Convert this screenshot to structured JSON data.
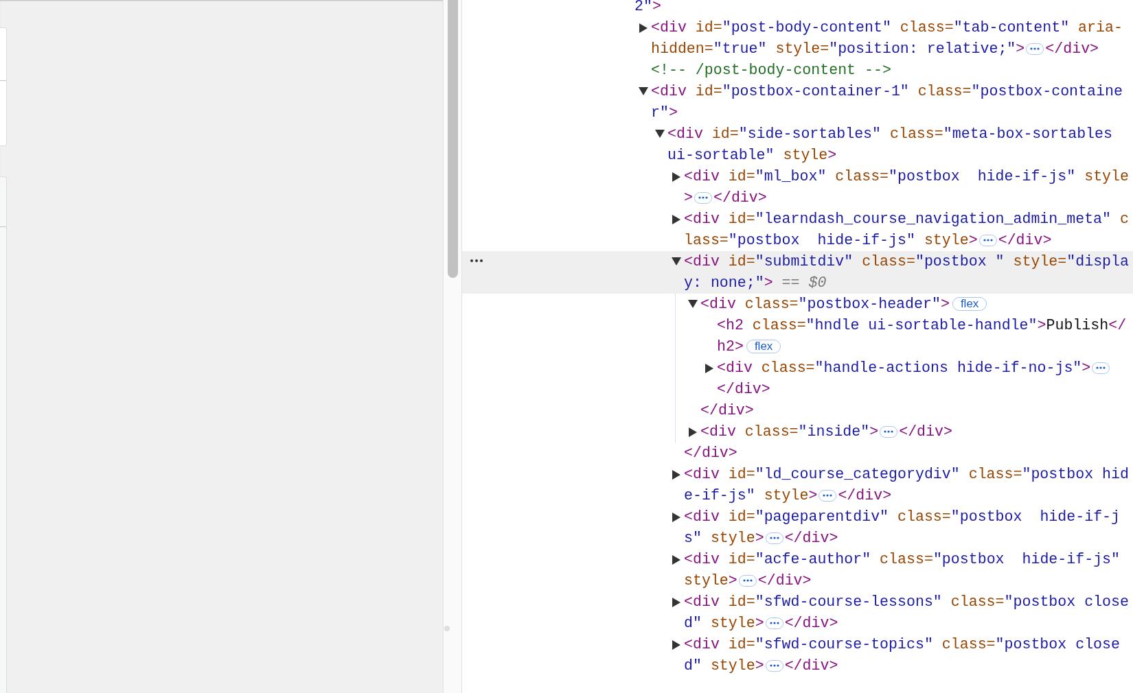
{
  "dom_tree": {
    "continuation_parts": [
      {
        "kind": "value",
        "text": "2\""
      },
      {
        "kind": "tag",
        "text": ">"
      }
    ],
    "nodes": [
      {
        "kind": "element",
        "expanded": false,
        "selected": false,
        "parts": [
          {
            "kind": "tag",
            "text": "<div"
          },
          {
            "kind": "attr",
            "text": " id="
          },
          {
            "kind": "value",
            "text": "\"post-body-content\""
          },
          {
            "kind": "attr",
            "text": " class="
          },
          {
            "kind": "value",
            "text": "\"tab-content\""
          },
          {
            "kind": "attr",
            "text": " aria-hidden="
          },
          {
            "kind": "value",
            "text": "\"true\""
          },
          {
            "kind": "attr",
            "text": " style="
          },
          {
            "kind": "value",
            "text": "\"position: relative;\""
          },
          {
            "kind": "tag",
            "text": ">"
          },
          {
            "kind": "ellipsis"
          },
          {
            "kind": "tag",
            "text": "</div>"
          }
        ]
      },
      {
        "kind": "comment",
        "parts": [
          {
            "kind": "comment",
            "text": "<!-- /post-body-content -->"
          }
        ]
      },
      {
        "kind": "element",
        "expanded": true,
        "selected": false,
        "parts": [
          {
            "kind": "tag",
            "text": "<div"
          },
          {
            "kind": "attr",
            "text": " id="
          },
          {
            "kind": "value",
            "text": "\"postbox-container-1\""
          },
          {
            "kind": "attr",
            "text": " class="
          },
          {
            "kind": "value",
            "text": "\"postbox-container\""
          },
          {
            "kind": "tag",
            "text": ">"
          }
        ],
        "children": [
          {
            "kind": "element",
            "expanded": true,
            "selected": false,
            "parts": [
              {
                "kind": "tag",
                "text": "<div"
              },
              {
                "kind": "attr",
                "text": " id="
              },
              {
                "kind": "value",
                "text": "\"side-sortables\""
              },
              {
                "kind": "attr",
                "text": " class="
              },
              {
                "kind": "value",
                "text": "\"meta-box-sortables ui-sortable\""
              },
              {
                "kind": "attr",
                "text": " style"
              },
              {
                "kind": "tag",
                "text": ">"
              }
            ],
            "children": [
              {
                "kind": "element",
                "expanded": false,
                "selected": false,
                "parts": [
                  {
                    "kind": "tag",
                    "text": "<div"
                  },
                  {
                    "kind": "attr",
                    "text": " id="
                  },
                  {
                    "kind": "value",
                    "text": "\"ml_box\""
                  },
                  {
                    "kind": "attr",
                    "text": " class="
                  },
                  {
                    "kind": "value",
                    "text": "\"postbox  hide-if-js\""
                  },
                  {
                    "kind": "attr",
                    "text": " style"
                  },
                  {
                    "kind": "tag",
                    "text": ">"
                  },
                  {
                    "kind": "ellipsis"
                  },
                  {
                    "kind": "tag",
                    "text": "</div>"
                  }
                ]
              },
              {
                "kind": "element",
                "expanded": false,
                "selected": false,
                "parts": [
                  {
                    "kind": "tag",
                    "text": "<div"
                  },
                  {
                    "kind": "attr",
                    "text": " id="
                  },
                  {
                    "kind": "value",
                    "text": "\"learndash_course_navigation_admin_meta\""
                  },
                  {
                    "kind": "attr",
                    "text": " class="
                  },
                  {
                    "kind": "value",
                    "text": "\"postbox  hide-if-js\""
                  },
                  {
                    "kind": "attr",
                    "text": " style"
                  },
                  {
                    "kind": "tag",
                    "text": ">"
                  },
                  {
                    "kind": "ellipsis"
                  },
                  {
                    "kind": "tag",
                    "text": "</div>"
                  }
                ]
              },
              {
                "kind": "element",
                "expanded": true,
                "selected": true,
                "parts": [
                  {
                    "kind": "tag",
                    "text": "<div"
                  },
                  {
                    "kind": "attr",
                    "text": " id="
                  },
                  {
                    "kind": "value",
                    "text": "\"submitdiv\""
                  },
                  {
                    "kind": "attr",
                    "text": " class="
                  },
                  {
                    "kind": "value",
                    "text": "\"postbox \""
                  },
                  {
                    "kind": "attr",
                    "text": " style="
                  },
                  {
                    "kind": "value",
                    "text": "\"display: none;\""
                  },
                  {
                    "kind": "tag",
                    "text": ">"
                  },
                  {
                    "kind": "marker",
                    "text": " == $0"
                  }
                ],
                "children": [
                  {
                    "kind": "element",
                    "expanded": true,
                    "selected": false,
                    "parts": [
                      {
                        "kind": "tag",
                        "text": "<div"
                      },
                      {
                        "kind": "attr",
                        "text": " class="
                      },
                      {
                        "kind": "value",
                        "text": "\"postbox-header\""
                      },
                      {
                        "kind": "tag",
                        "text": ">"
                      },
                      {
                        "kind": "badge",
                        "text": "flex"
                      }
                    ],
                    "children": [
                      {
                        "kind": "leaf",
                        "parts": [
                          {
                            "kind": "tag",
                            "text": "<h2"
                          },
                          {
                            "kind": "attr",
                            "text": " class="
                          },
                          {
                            "kind": "value",
                            "text": "\"hndle ui-sortable-handle\""
                          },
                          {
                            "kind": "tag",
                            "text": ">"
                          },
                          {
                            "kind": "text",
                            "text": "Publish"
                          },
                          {
                            "kind": "tag",
                            "text": "</h2>"
                          },
                          {
                            "kind": "badge",
                            "text": "flex"
                          }
                        ]
                      },
                      {
                        "kind": "element",
                        "expanded": false,
                        "selected": false,
                        "parts": [
                          {
                            "kind": "tag",
                            "text": "<div"
                          },
                          {
                            "kind": "attr",
                            "text": " class="
                          },
                          {
                            "kind": "value",
                            "text": "\"handle-actions hide-if-no-js\""
                          },
                          {
                            "kind": "tag",
                            "text": ">"
                          },
                          {
                            "kind": "ellipsis"
                          },
                          {
                            "kind": "tag",
                            "text": "</div>"
                          }
                        ]
                      }
                    ],
                    "close": [
                      {
                        "kind": "tag",
                        "text": "</div>"
                      }
                    ]
                  },
                  {
                    "kind": "element",
                    "expanded": false,
                    "selected": false,
                    "parts": [
                      {
                        "kind": "tag",
                        "text": "<div"
                      },
                      {
                        "kind": "attr",
                        "text": " class="
                      },
                      {
                        "kind": "value",
                        "text": "\"inside\""
                      },
                      {
                        "kind": "tag",
                        "text": ">"
                      },
                      {
                        "kind": "ellipsis"
                      },
                      {
                        "kind": "tag",
                        "text": "</div>"
                      }
                    ]
                  }
                ],
                "close": [
                  {
                    "kind": "tag",
                    "text": "</div>"
                  }
                ]
              },
              {
                "kind": "element",
                "expanded": false,
                "selected": false,
                "parts": [
                  {
                    "kind": "tag",
                    "text": "<div"
                  },
                  {
                    "kind": "attr",
                    "text": " id="
                  },
                  {
                    "kind": "value",
                    "text": "\"ld_course_categorydiv\""
                  },
                  {
                    "kind": "attr",
                    "text": " class="
                  },
                  {
                    "kind": "value",
                    "text": "\"postbox hide-if-js\""
                  },
                  {
                    "kind": "attr",
                    "text": " style"
                  },
                  {
                    "kind": "tag",
                    "text": ">"
                  },
                  {
                    "kind": "ellipsis"
                  },
                  {
                    "kind": "tag",
                    "text": "</div>"
                  }
                ]
              },
              {
                "kind": "element",
                "expanded": false,
                "selected": false,
                "parts": [
                  {
                    "kind": "tag",
                    "text": "<div"
                  },
                  {
                    "kind": "attr",
                    "text": " id="
                  },
                  {
                    "kind": "value",
                    "text": "\"pageparentdiv\""
                  },
                  {
                    "kind": "attr",
                    "text": " class="
                  },
                  {
                    "kind": "value",
                    "text": "\"postbox  hide-if-js\""
                  },
                  {
                    "kind": "attr",
                    "text": " style"
                  },
                  {
                    "kind": "tag",
                    "text": ">"
                  },
                  {
                    "kind": "ellipsis"
                  },
                  {
                    "kind": "tag",
                    "text": "</div>"
                  }
                ]
              },
              {
                "kind": "element",
                "expanded": false,
                "selected": false,
                "parts": [
                  {
                    "kind": "tag",
                    "text": "<div"
                  },
                  {
                    "kind": "attr",
                    "text": " id="
                  },
                  {
                    "kind": "value",
                    "text": "\"acfe-author\""
                  },
                  {
                    "kind": "attr",
                    "text": " class="
                  },
                  {
                    "kind": "value",
                    "text": "\"postbox  hide-if-js\""
                  },
                  {
                    "kind": "attr",
                    "text": " style"
                  },
                  {
                    "kind": "tag",
                    "text": ">"
                  },
                  {
                    "kind": "ellipsis"
                  },
                  {
                    "kind": "tag",
                    "text": "</div>"
                  }
                ]
              },
              {
                "kind": "element",
                "expanded": false,
                "selected": false,
                "parts": [
                  {
                    "kind": "tag",
                    "text": "<div"
                  },
                  {
                    "kind": "attr",
                    "text": " id="
                  },
                  {
                    "kind": "value",
                    "text": "\"sfwd-course-lessons\""
                  },
                  {
                    "kind": "attr",
                    "text": " class="
                  },
                  {
                    "kind": "value",
                    "text": "\"postbox closed\""
                  },
                  {
                    "kind": "attr",
                    "text": " style"
                  },
                  {
                    "kind": "tag",
                    "text": ">"
                  },
                  {
                    "kind": "ellipsis"
                  },
                  {
                    "kind": "tag",
                    "text": "</div>"
                  }
                ]
              },
              {
                "kind": "element",
                "expanded": false,
                "selected": false,
                "parts": [
                  {
                    "kind": "tag",
                    "text": "<div"
                  },
                  {
                    "kind": "attr",
                    "text": " id="
                  },
                  {
                    "kind": "value",
                    "text": "\"sfwd-course-topics\""
                  },
                  {
                    "kind": "attr",
                    "text": " class="
                  },
                  {
                    "kind": "value",
                    "text": "\"postbox closed\""
                  },
                  {
                    "kind": "attr",
                    "text": " style"
                  },
                  {
                    "kind": "tag",
                    "text": ">"
                  },
                  {
                    "kind": "ellipsis"
                  },
                  {
                    "kind": "tag",
                    "text": "</div>"
                  }
                ]
              }
            ]
          }
        ]
      }
    ]
  }
}
